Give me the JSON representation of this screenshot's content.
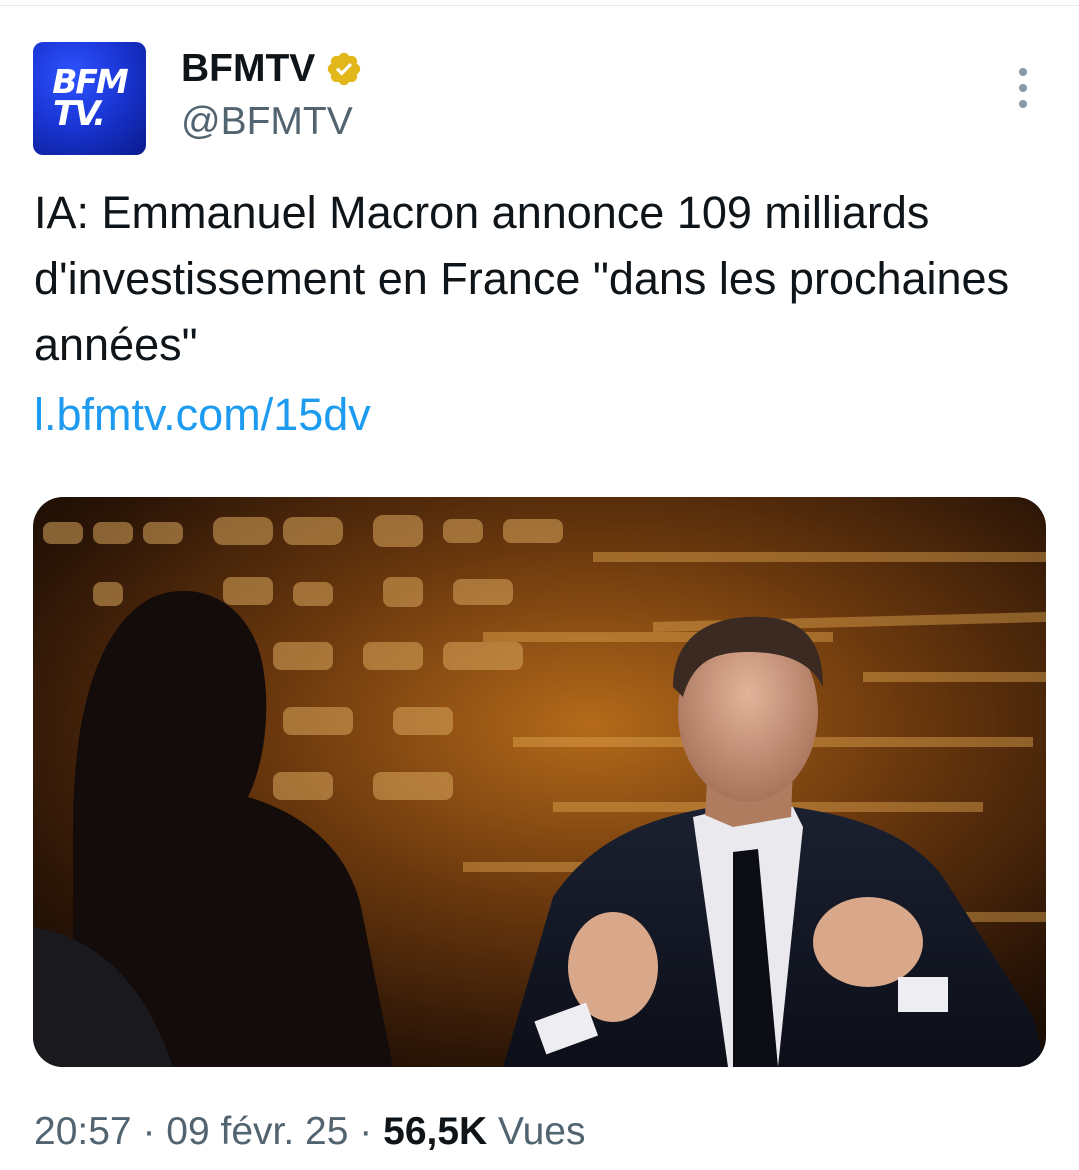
{
  "author": {
    "avatar_text_line1": "BFM",
    "avatar_text_line2": "TV.",
    "display_name": "BFMTV",
    "handle": "@BFMTV",
    "verified": true,
    "verified_color": "#e2b719",
    "avatar_color": "#1a36d6"
  },
  "tweet": {
    "text": "IA: Emmanuel Macron annonce 109 milliards d'investissement en France \"dans les prochaines années\"",
    "link": "l.bfmtv.com/15dv",
    "link_color": "#1d9bf0"
  },
  "media": {
    "description_icon": "photo"
  },
  "meta": {
    "time": "20:57",
    "separator": "·",
    "date": "09 févr. 25",
    "views_count": "56,5K",
    "views_label": "Vues"
  },
  "icons": {
    "verified": "verified-badge-icon",
    "more": "more-options-icon"
  }
}
